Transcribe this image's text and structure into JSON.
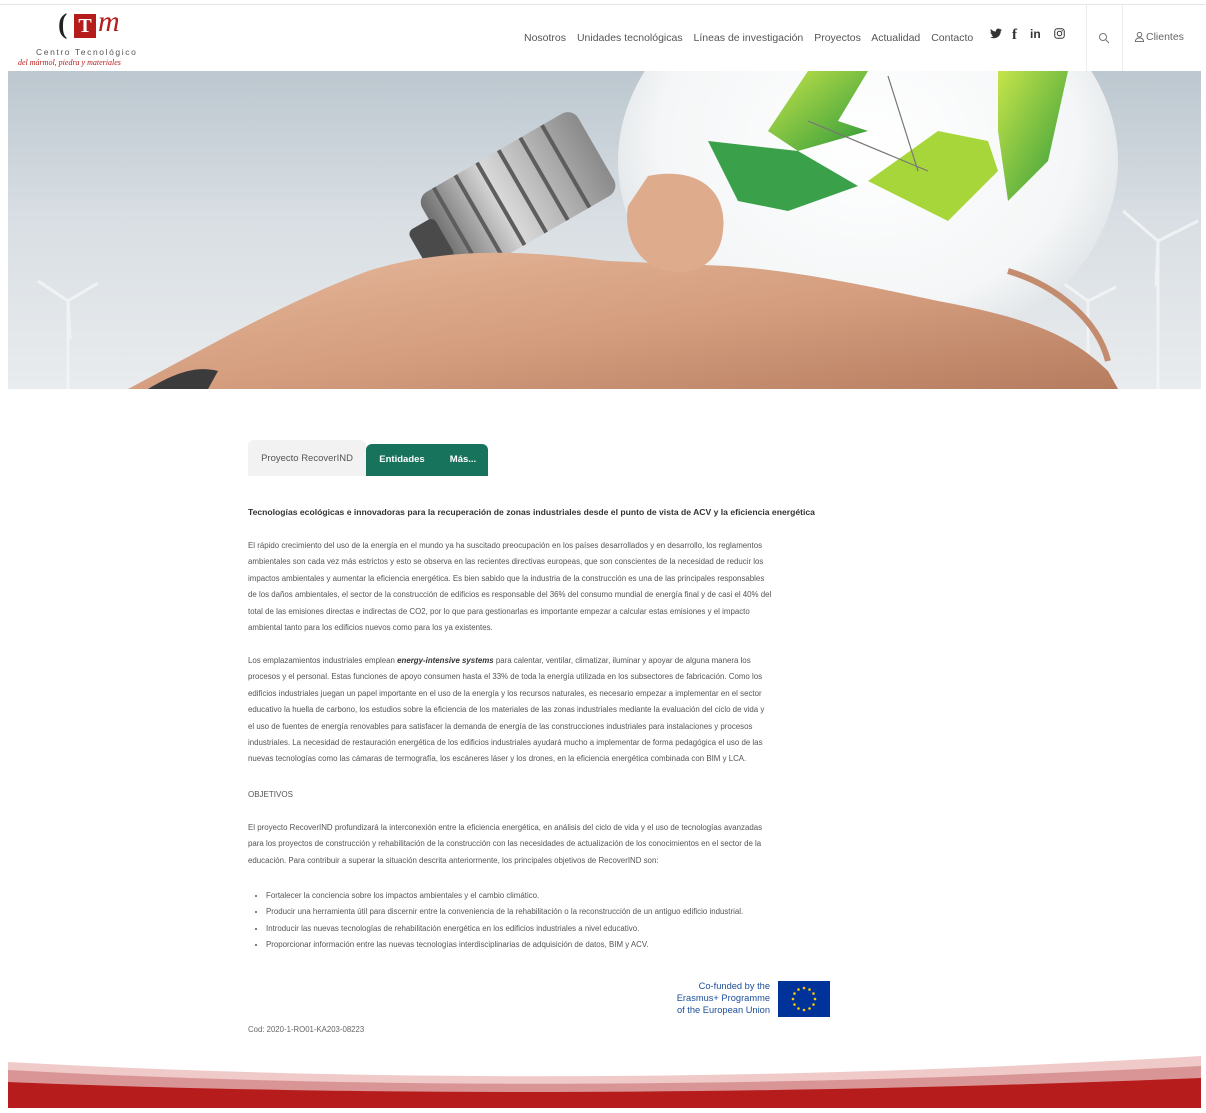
{
  "header": {
    "logo": {
      "mark_paren": "(",
      "mark_letter": "T",
      "mark_script": "m",
      "line1": "Centro Tecnológico",
      "line2": "del mármol, piedra y materiales"
    },
    "nav": [
      "Nosotros",
      "Unidades tecnológicas",
      "Líneas de investigación",
      "Proyectos",
      "Actualidad",
      "Contacto"
    ],
    "social": [
      {
        "icon": "twitter-icon",
        "glyph": "🐦"
      },
      {
        "icon": "facebook-icon",
        "glyph": "f"
      },
      {
        "icon": "linkedin-icon",
        "glyph": "in"
      },
      {
        "icon": "instagram-icon",
        "glyph": "◎"
      }
    ],
    "clientes_label": "Clientes"
  },
  "tabs": [
    {
      "label": "Proyecto RecoverIND",
      "active": false
    },
    {
      "label": "Entidades",
      "active": true
    },
    {
      "label": "Más...",
      "active": true
    }
  ],
  "article": {
    "subtitle": "Tecnologías ecológicas e innovadoras para la recuperación de zonas industriales desde el punto de vista de ACV y la eficiencia energética",
    "para1": [
      "El rápido crecimiento del uso de la energía en el mundo ya ha suscitado preocupación en los países desarrollados y en desarrollo, los reglamentos",
      "ambientales son cada vez más estrictos y esto se observa en las recientes directivas europeas, que son conscientes de la necesidad de reducir los",
      "impactos ambientales y aumentar la eficiencia energética. Es bien sabido que la industria de la construcción es una de las principales responsables",
      "de los daños ambientales, el sector de la construcción de edificios es responsable del 36% del consumo mundial de energía final y de casi el 40% del",
      "total de las emisiones directas e indirectas de CO2, por lo que para gestionarlas es importante empezar a calcular estas emisiones y el impacto",
      "ambiental tanto para los edificios nuevos como para los ya existentes."
    ],
    "para2_first_pre": "Los emplazamientos industriales emplean ",
    "para2_first_em": "energy-intensive systems",
    "para2_first_post": " para calentar, ventilar, climatizar, iluminar y apoyar de alguna manera los",
    "para2_rest": [
      "procesos y el personal. Estas funciones de apoyo consumen hasta el 33% de toda la energía utilizada en los subsectores de fabricación. Como los",
      "edificios industriales juegan un papel importante en el uso de la energía y los recursos naturales, es necesario empezar a implementar en el sector",
      "educativo la huella de carbono, los estudios sobre la eficiencia de los materiales de las zonas industriales mediante la evaluación del ciclo de vida y",
      "el uso de fuentes de energía renovables para satisfacer la demanda de energía de las construcciones industriales para instalaciones y procesos",
      "industriales. La necesidad de restauración energética de los edificios industriales ayudará mucho a implementar de forma pedagógica el uso de las",
      "nuevas tecnologías como las cámaras de termografía, los escáneres láser y los drones, en la eficiencia energética combinada con BIM y LCA."
    ],
    "objetivos_heading": "OBJETIVOS",
    "para3": [
      "El proyecto RecoverIND profundizará la interconexión entre la eficiencia energética, en análisis del ciclo de vida y el uso de tecnologías avanzadas",
      "para los proyectos de construcción y rehabilitación de la construcción con las necesidades de actualización de los conocimientos en el sector de la",
      "educación. Para contribuir a superar la situación descrita anteriormente, los principales objetivos de RecoverIND son:"
    ],
    "objectives": [
      "Fortalecer la conciencia sobre los impactos ambientales y el cambio climático.",
      "Producir una herramienta útil para discernir entre la conveniencia de la rehabilitación o la reconstrucción de un antiguo edificio industrial.",
      "Introducir las nuevas tecnologías de rehabilitación energética en los edificios industriales a nivel educativo.",
      "Proporcionar información entre las nuevas tecnologías interdisciplinarias de adquisición de datos, BIM y ACV."
    ],
    "cofund_lines": [
      "Co-funded by the",
      "Erasmus+ Programme",
      "of the European Union"
    ],
    "code": "Cod: 2020-1-RO01-KA203-08223"
  },
  "colors": {
    "brand_red": "#b71c1c",
    "tab_green": "#17735c",
    "eu_blue": "#003399",
    "eu_star": "#ffcc00"
  }
}
